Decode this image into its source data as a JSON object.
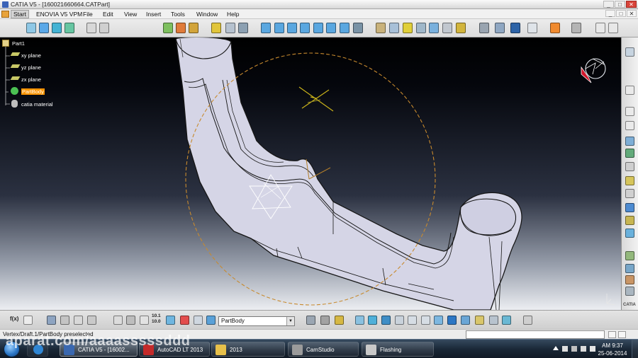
{
  "window": {
    "title": "CATIA V5 - [160021660664.CATPart]",
    "minimize": "_",
    "maximize": "□",
    "close": "✕"
  },
  "menubar": {
    "items": [
      "Start",
      "ENOVIA V5 VPM",
      "File",
      "Edit",
      "View",
      "Insert",
      "Tools",
      "Window",
      "Help"
    ],
    "doc_controls": [
      "_",
      "□",
      "✕"
    ]
  },
  "tree": {
    "root": "Part1",
    "items": [
      "xy plane",
      "yz plane",
      "zx plane",
      "PartBody",
      "catia material"
    ],
    "selected": "PartBody"
  },
  "compass": {
    "axis_z": "z",
    "axis_x": "x",
    "axis_y": "y"
  },
  "toolbar_bottom": {
    "fx_label": "f(x)",
    "scale_top": "10.1",
    "scale_bottom": "10.0",
    "body_select": "PartBody"
  },
  "statusbar": {
    "message": "Vertex/Draft.1/PartBody preselected"
  },
  "right_toolbar": {
    "brand": "CATIA"
  },
  "taskbar": {
    "tasks": [
      {
        "label": "CATIA V5 - [16002...",
        "active": true
      },
      {
        "label": "AutoCAD LT 2013",
        "active": false
      },
      {
        "label": "2013",
        "active": false
      },
      {
        "label": "CamStudio",
        "active": false
      },
      {
        "label": "Flashing",
        "active": false
      }
    ],
    "clock_time": "AM 9:37",
    "clock_date": "25-06-2014"
  },
  "watermark": {
    "text": "aparat.com/aaaasssssddd"
  },
  "colors": {
    "selection": "#ff9400",
    "axis_triad_red": "#d2162a",
    "model_fill": "#d6d6e8",
    "sketch_circle": "#c88a2e"
  },
  "icons": {
    "top_toolbar": [
      "product-icon",
      "sheet-icon",
      "sketch-icon",
      "part-icon",
      "new-icon",
      "open-icon",
      "swap-icon",
      "select-icon",
      "material-icon",
      "apply-icon",
      "sphere-icon",
      "cube-views-icon",
      "view-front-icon",
      "view-back-icon",
      "view-left-icon",
      "view-right-icon",
      "view-top-icon",
      "view-bottom-icon",
      "view-iso-icon",
      "render-icon",
      "shading-icon",
      "box-icon",
      "measure-icon",
      "hide-show-icon",
      "swap-visible-icon",
      "axis-icon",
      "grid-icon",
      "analysis-icon",
      "compass-icon",
      "paint-icon",
      "snapshot-icon",
      "dot-icon",
      "line-icon"
    ],
    "bottom_toolbar": [
      "formula-icon",
      "comment-icon",
      "table-icon",
      "tree-expand-icon",
      "params-icon",
      "constraint-icon",
      "rotate-icon",
      "swept-icon",
      "axis-system-icon",
      "scale-icon",
      "transform-icon",
      "copy-icon",
      "body-icon",
      "dashboard-icon",
      "snap-icon",
      "measure-item-icon",
      "fly-icon",
      "fit-all-icon",
      "pan-icon",
      "rotate-view-icon",
      "zoom-in-icon",
      "zoom-out-icon",
      "normal-view-icon",
      "iso-view-icon",
      "3d-view-icon",
      "hide-icon",
      "swap-space-icon",
      "analysis-icon-2",
      "apply-material-icon"
    ],
    "right_toolbar": [
      "sketcher-icon",
      "pad-icon",
      "pocket-icon",
      "shaft-icon",
      "hole-icon",
      "rib-icon",
      "slot-icon",
      "stiffener-icon",
      "multi-pad-icon",
      "fillet-icon",
      "chamfer-icon",
      "draft-icon",
      "shell-icon",
      "thickness-icon",
      "thread-icon",
      "mirror-icon",
      "pattern-icon",
      "boolean-icon"
    ]
  }
}
